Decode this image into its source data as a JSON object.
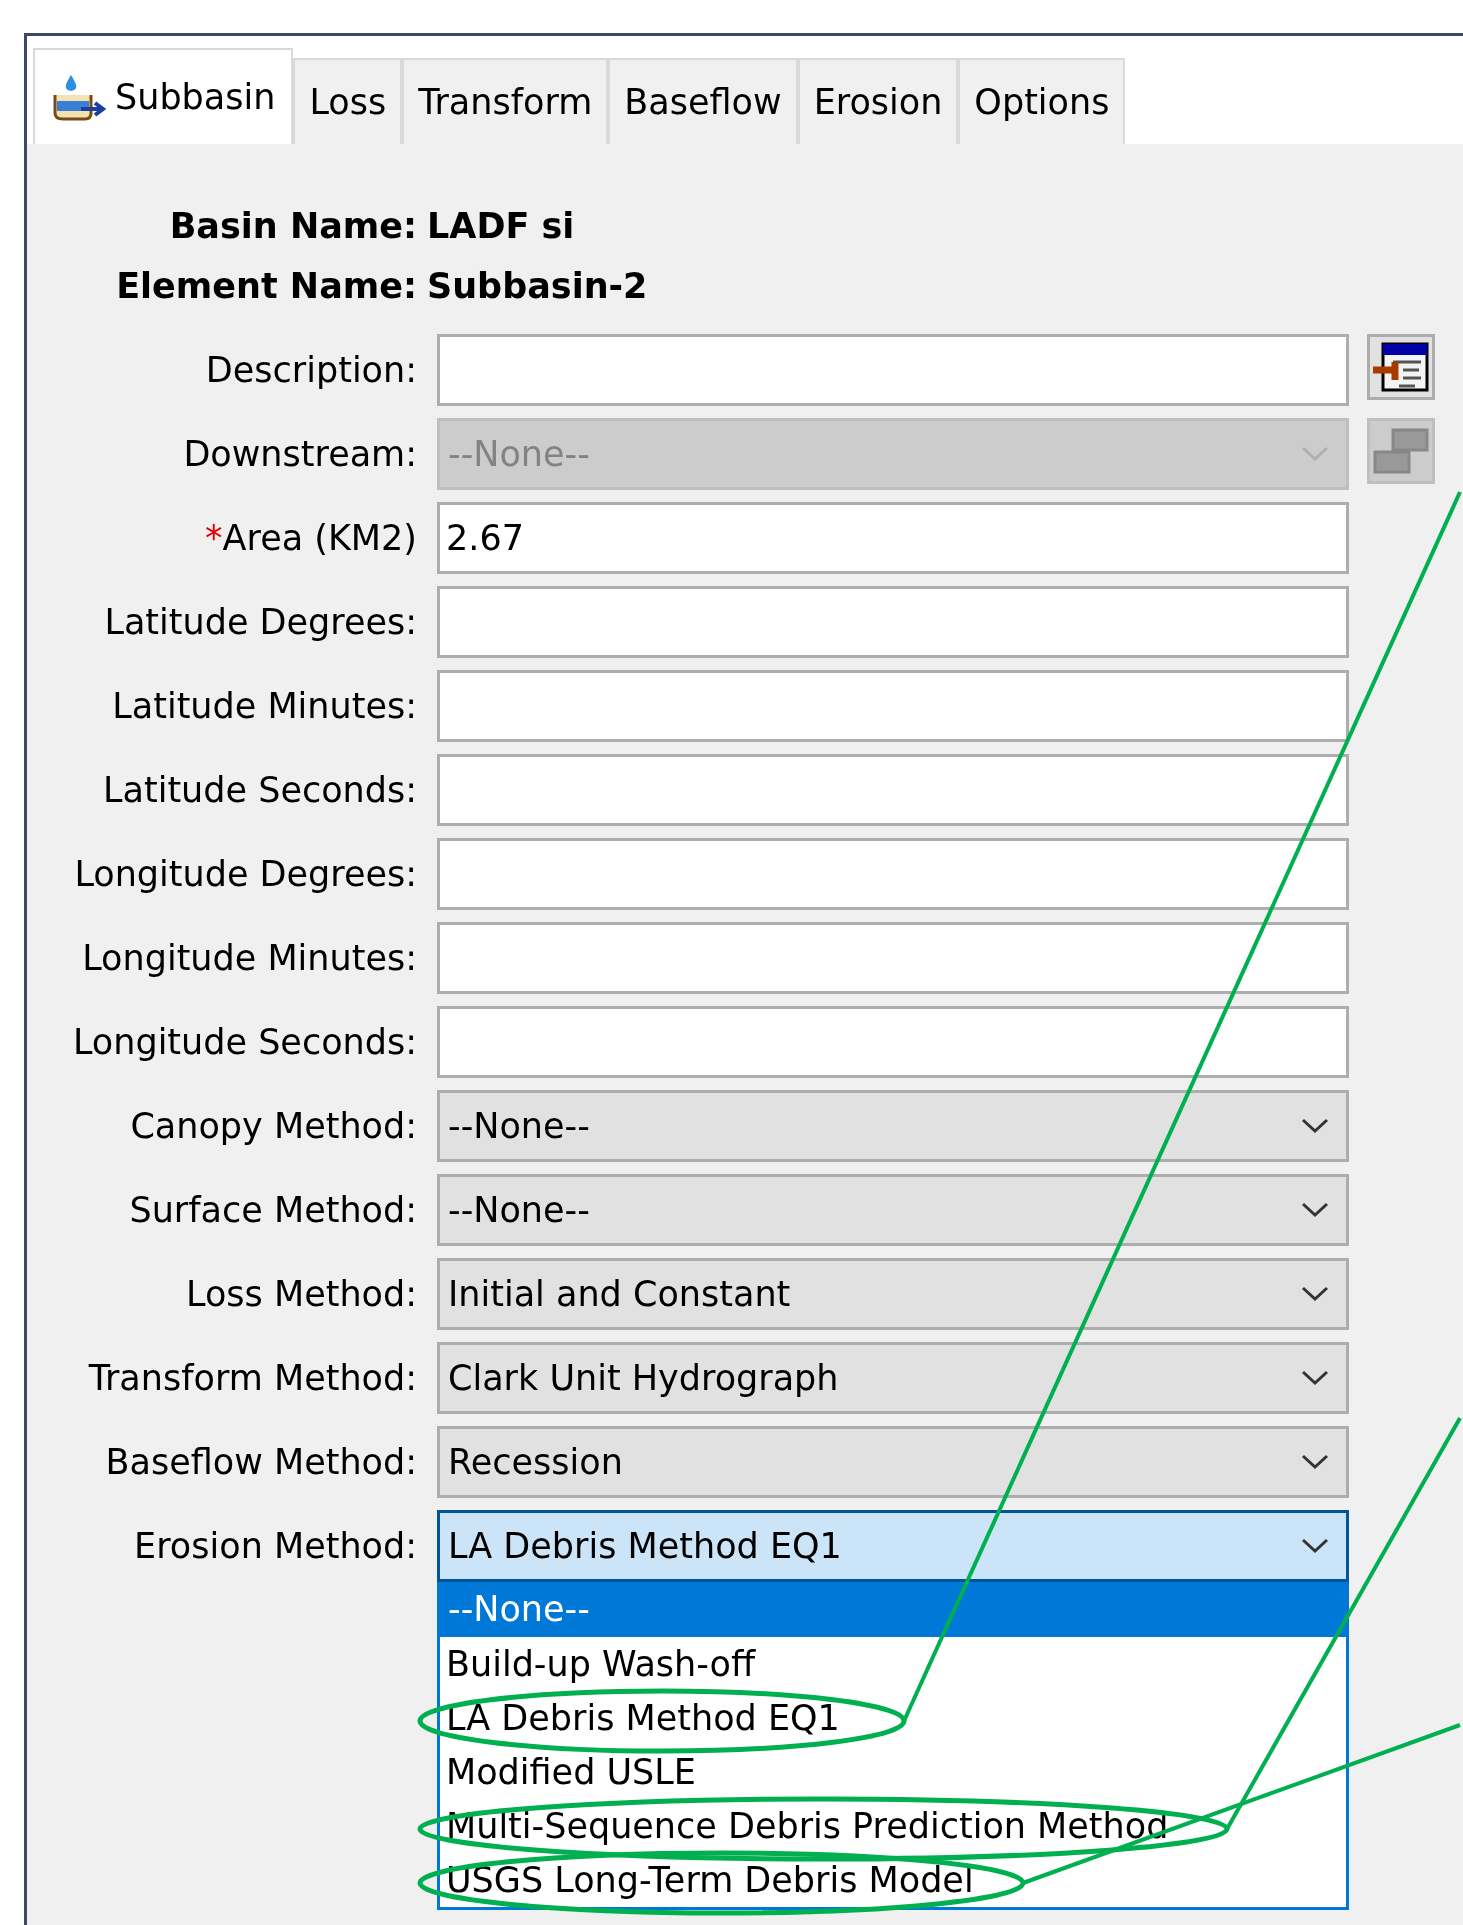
{
  "tabs": [
    {
      "label": "Subbasin",
      "selected": true,
      "icon": true
    },
    {
      "label": "Loss",
      "selected": false,
      "icon": false
    },
    {
      "label": "Transform",
      "selected": false,
      "icon": false
    },
    {
      "label": "Baseflow",
      "selected": false,
      "icon": false
    },
    {
      "label": "Erosion",
      "selected": false,
      "icon": false
    },
    {
      "label": "Options",
      "selected": false,
      "icon": false
    }
  ],
  "info": [
    {
      "label": "Basin Name:",
      "value": "LADF si"
    },
    {
      "label": "Element Name:",
      "value": "Subbasin-2"
    }
  ],
  "fields": [
    {
      "label": "Description:",
      "kind": "text",
      "disabled": false,
      "side_button": {
        "disabled": false
      }
    },
    {
      "label": "Downstream:",
      "kind": "select",
      "value": "--None--",
      "disabled": true,
      "open": false,
      "side_button": {
        "disabled": true
      }
    },
    {
      "label": "Area (KM2)",
      "marker": "*",
      "kind": "text",
      "value": "2.67",
      "disabled": false
    },
    {
      "label": "Latitude Degrees:",
      "kind": "text",
      "disabled": false
    },
    {
      "label": "Latitude Minutes:",
      "kind": "text",
      "disabled": false
    },
    {
      "label": "Latitude Seconds:",
      "kind": "text",
      "disabled": false
    },
    {
      "label": "Longitude Degrees:",
      "kind": "text",
      "disabled": false
    },
    {
      "label": "Longitude Minutes:",
      "kind": "text",
      "disabled": false
    },
    {
      "label": "Longitude Seconds:",
      "kind": "text",
      "disabled": false
    },
    {
      "label": "Canopy Method:",
      "kind": "select",
      "value": "--None--",
      "disabled": false,
      "open": false
    },
    {
      "label": "Surface Method:",
      "kind": "select",
      "value": "--None--",
      "disabled": false,
      "open": false
    },
    {
      "label": "Loss Method:",
      "kind": "select",
      "value": "Initial and Constant",
      "disabled": false,
      "open": false
    },
    {
      "label": "Transform Method:",
      "kind": "select",
      "value": "Clark Unit Hydrograph",
      "disabled": false,
      "open": false
    },
    {
      "label": "Baseflow Method:",
      "kind": "select",
      "value": "Recession",
      "disabled": false,
      "open": false
    },
    {
      "label": "Erosion Method:",
      "kind": "select",
      "value": "LA Debris Method EQ1",
      "disabled": false,
      "open": true,
      "options": [
        {
          "label": "--None--",
          "highlighted": true,
          "circled": false
        },
        {
          "label": "Build-up Wash-off",
          "highlighted": false,
          "circled": false
        },
        {
          "label": "LA Debris Method EQ1",
          "highlighted": false,
          "circled": true
        },
        {
          "label": "Modified USLE",
          "highlighted": false,
          "circled": false
        },
        {
          "label": "Multi-Sequence Debris Prediction Method",
          "highlighted": false,
          "circled": true
        },
        {
          "label": "USGS Long-Term Debris Model",
          "highlighted": false,
          "circled": true
        }
      ]
    }
  ]
}
